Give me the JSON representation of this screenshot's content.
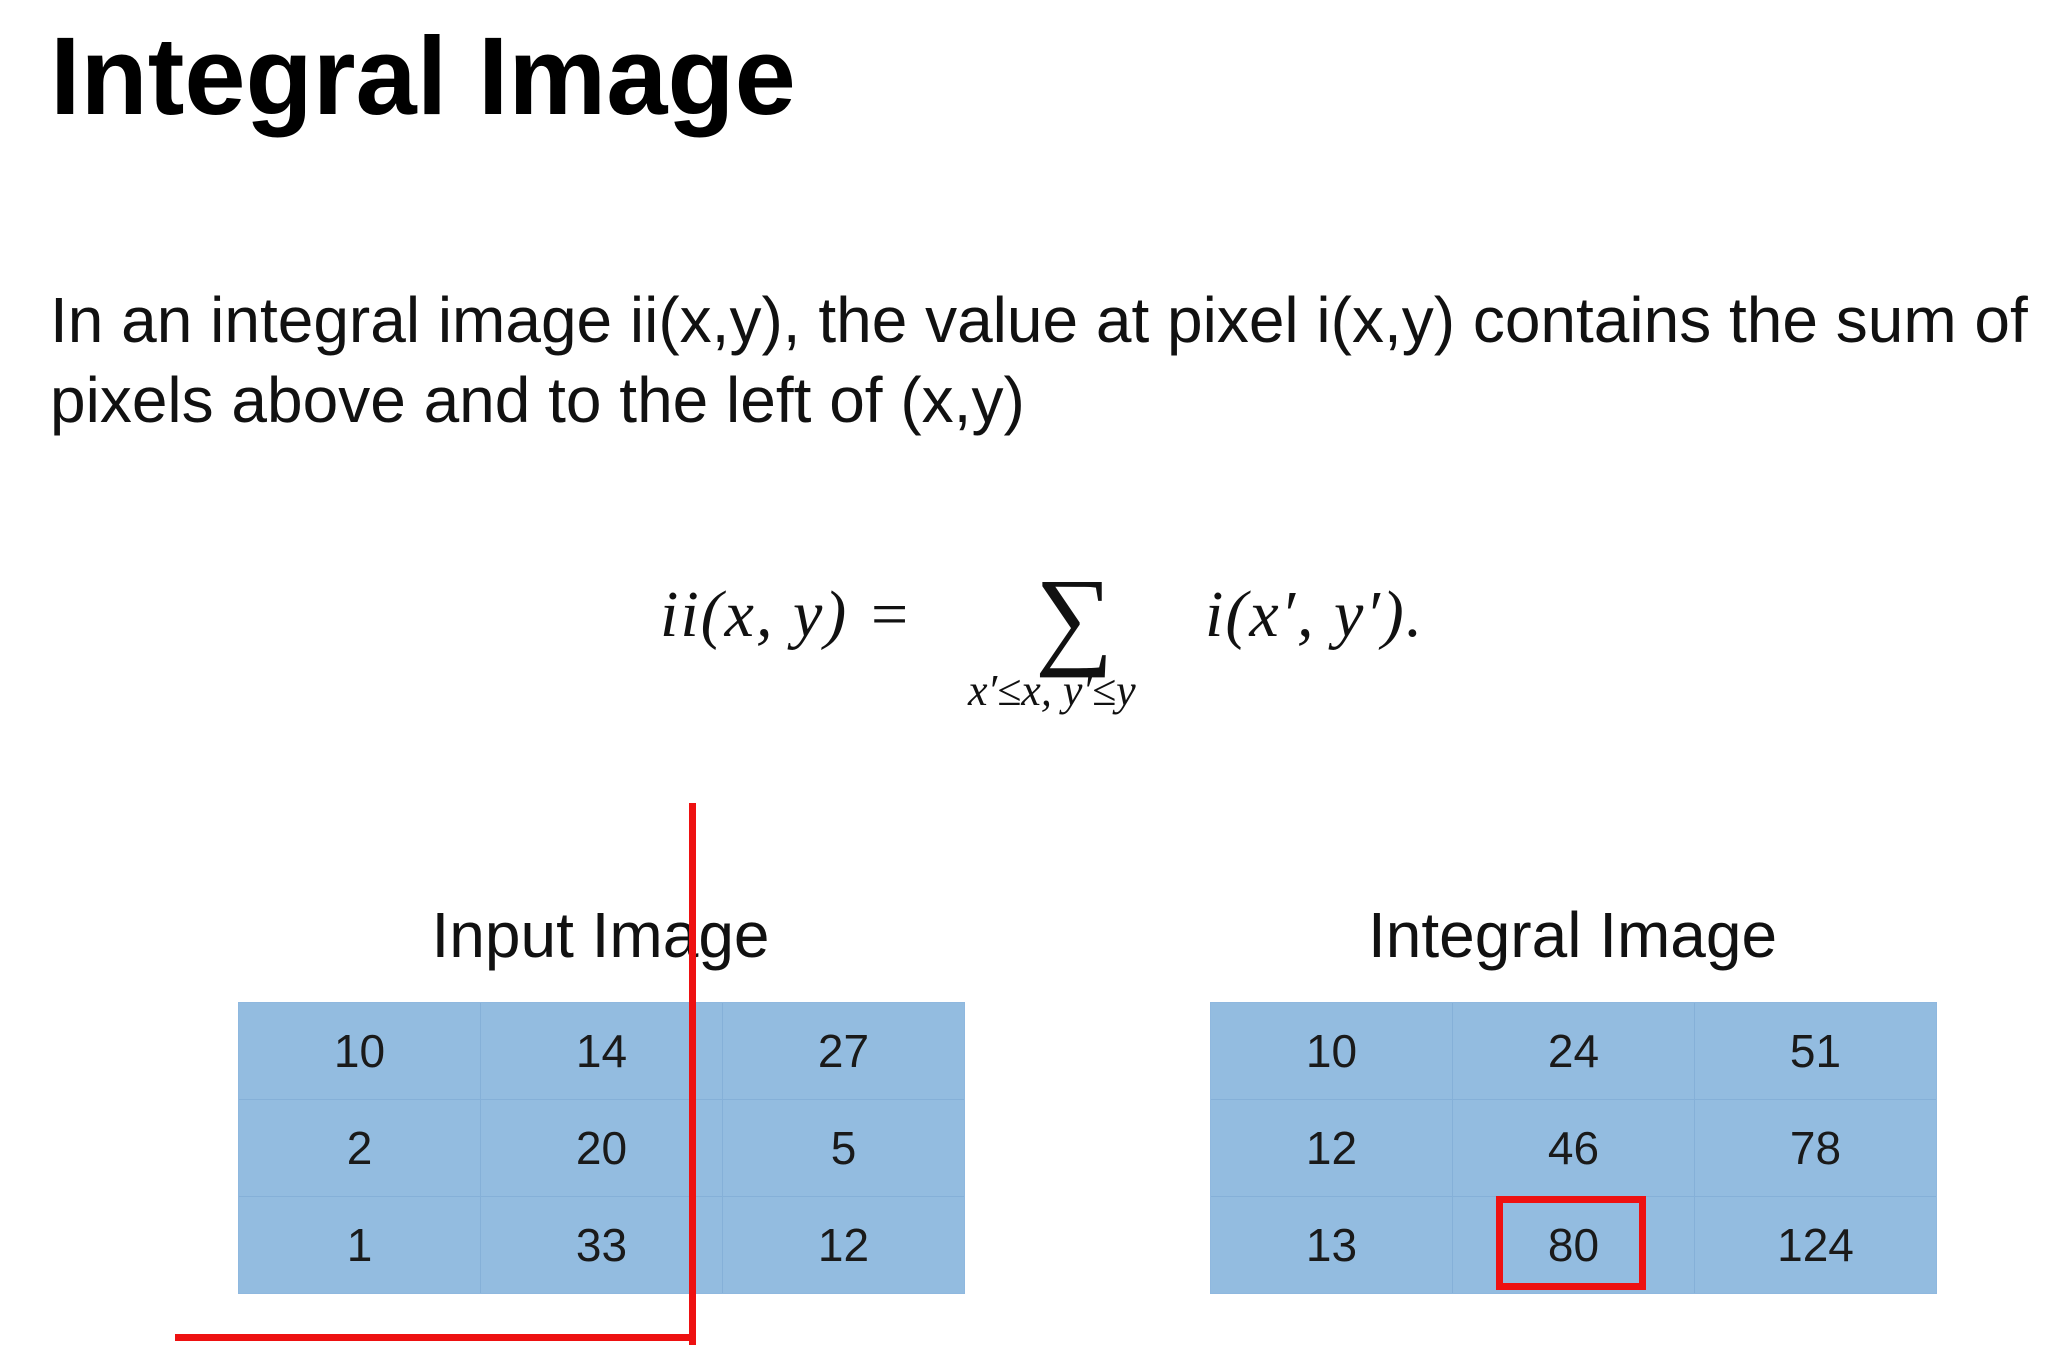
{
  "title": "Integral Image",
  "description": "In an integral image ii(x,y), the value at pixel i(x,y) contains the sum of pixels above and to the left of (x,y)",
  "formula": {
    "lhs": "ii(x, y) =",
    "sigma": "∑",
    "limits": "x′≤x, y′≤y",
    "rhs": "i(x′, y′)."
  },
  "input_image": {
    "label": "Input Image",
    "rows": [
      [
        "10",
        "14",
        "27"
      ],
      [
        "2",
        "20",
        "5"
      ],
      [
        "1",
        "33",
        "12"
      ]
    ]
  },
  "integral_image": {
    "label": "Integral Image",
    "rows": [
      [
        "10",
        "24",
        "51"
      ],
      [
        "12",
        "46",
        "78"
      ],
      [
        "13",
        "80",
        "124"
      ]
    ]
  },
  "annotation": {
    "color": "#ee1111",
    "highlighted_cell": "80"
  },
  "colors": {
    "cell_fill": "#93bce0",
    "text": "#111111"
  }
}
